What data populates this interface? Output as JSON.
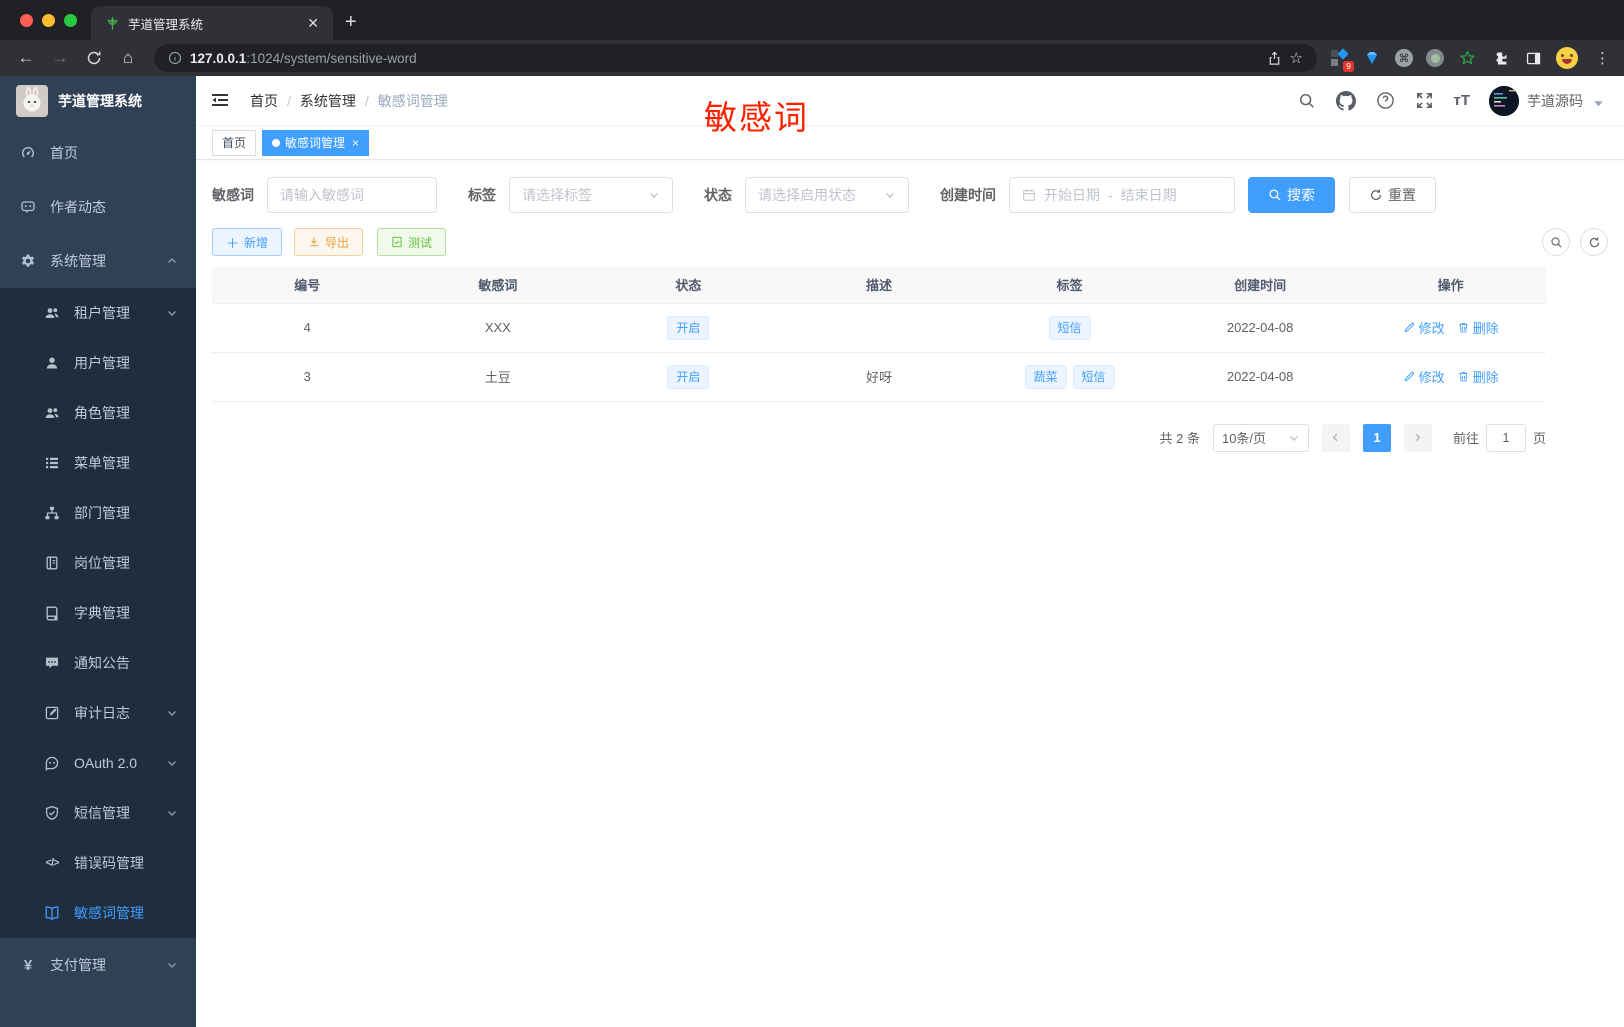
{
  "browser": {
    "tab_title": "芋道管理系统",
    "url_host": "127.0.0.1",
    "url_rest": ":1024/system/sensitive-word",
    "extension_badge": "9"
  },
  "sidebar": {
    "title": "芋道管理系统",
    "menu": [
      {
        "label": "首页",
        "icon": "dashboard-icon",
        "level": "top"
      },
      {
        "label": "作者动态",
        "icon": "author-icon",
        "level": "top"
      },
      {
        "label": "系统管理",
        "icon": "gear-icon",
        "level": "top",
        "chevron": "up"
      },
      {
        "label": "租户管理",
        "icon": "tenant-icon",
        "level": "sub",
        "chevron": "down"
      },
      {
        "label": "用户管理",
        "icon": "user-icon",
        "level": "sub"
      },
      {
        "label": "角色管理",
        "icon": "role-icon",
        "level": "sub"
      },
      {
        "label": "菜单管理",
        "icon": "menu-icon",
        "level": "sub"
      },
      {
        "label": "部门管理",
        "icon": "dept-icon",
        "level": "sub"
      },
      {
        "label": "岗位管理",
        "icon": "post-icon",
        "level": "sub"
      },
      {
        "label": "字典管理",
        "icon": "dict-icon",
        "level": "sub"
      },
      {
        "label": "通知公告",
        "icon": "notice-icon",
        "level": "sub"
      },
      {
        "label": "审计日志",
        "icon": "audit-icon",
        "level": "sub",
        "chevron": "down"
      },
      {
        "label": "OAuth 2.0",
        "icon": "oauth-icon",
        "level": "sub",
        "chevron": "down"
      },
      {
        "label": "短信管理",
        "icon": "sms-icon",
        "level": "sub",
        "chevron": "down"
      },
      {
        "label": "错误码管理",
        "icon": "errorcode-icon",
        "level": "sub"
      },
      {
        "label": "敏感词管理",
        "icon": "sensitive-word-icon",
        "level": "sub",
        "active": true
      },
      {
        "label": "支付管理",
        "icon": "pay-icon",
        "level": "top",
        "chevron": "down"
      }
    ]
  },
  "header": {
    "breadcrumb": [
      "首页",
      "系统管理",
      "敏感词管理"
    ],
    "user_name": "芋道源码"
  },
  "annotation": {
    "text": "敏感词",
    "color": "#ff2000"
  },
  "tags_view": [
    {
      "label": "首页",
      "active": false,
      "closable": false
    },
    {
      "label": "敏感词管理",
      "active": true,
      "closable": true
    }
  ],
  "filters": {
    "keyword": {
      "label": "敏感词",
      "placeholder": "请输入敏感词",
      "value": ""
    },
    "tag": {
      "label": "标签",
      "placeholder": "请选择标签"
    },
    "status": {
      "label": "状态",
      "placeholder": "请选择启用状态"
    },
    "create_time": {
      "label": "创建时间",
      "start_placeholder": "开始日期",
      "separator": "-",
      "end_placeholder": "结束日期"
    },
    "search_label": "搜索",
    "reset_label": "重置"
  },
  "actions": {
    "add": "新增",
    "export": "导出",
    "test": "测试"
  },
  "table": {
    "columns": [
      "编号",
      "敏感词",
      "状态",
      "描述",
      "标签",
      "创建时间",
      "操作"
    ],
    "rows": [
      {
        "id": "4",
        "word": "XXX",
        "status": "开启",
        "description": "",
        "tags": [
          "短信"
        ],
        "create_time": "2022-04-08"
      },
      {
        "id": "3",
        "word": "土豆",
        "status": "开启",
        "description": "好呀",
        "tags": [
          "蔬菜",
          "短信"
        ],
        "create_time": "2022-04-08"
      }
    ],
    "row_actions": {
      "edit": "修改",
      "delete": "删除"
    }
  },
  "pagination": {
    "total_text": "共 2 条",
    "page_size": "10条/页",
    "current_page": "1",
    "goto_label": "前往",
    "goto_value": "1",
    "page_unit": "页"
  },
  "colors": {
    "accent": "#409eff",
    "sidebar_bg": "#304156",
    "submenu_bg": "#1f2d3d"
  }
}
